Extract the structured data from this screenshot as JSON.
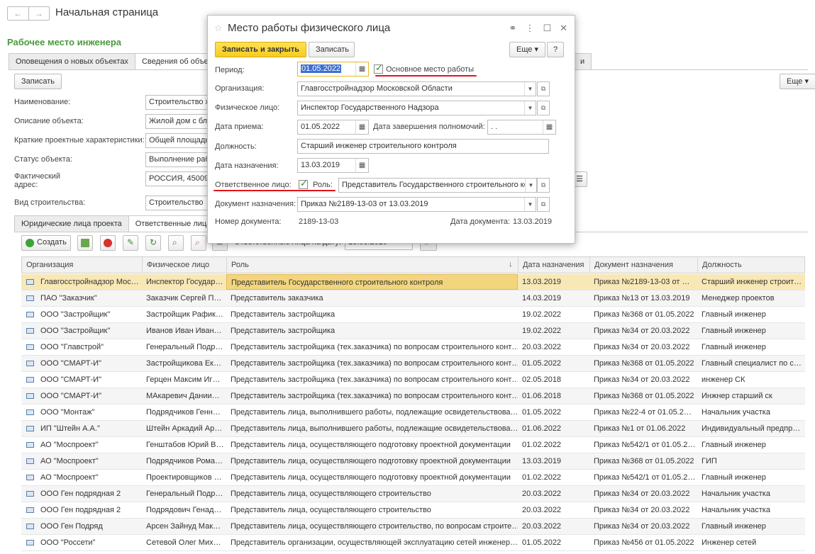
{
  "nav": {
    "back": "←",
    "forward": "→"
  },
  "page_title": "Начальная страница",
  "section_title": "Рабочее место инженера",
  "top_tabs": [
    "Оповещения о новых объектах",
    "Сведения об объекте",
    "и"
  ],
  "buttons": {
    "write": "Записать",
    "more": "Еще"
  },
  "form": {
    "name_label": "Наименование:",
    "name_value": "Строительство ж",
    "desc_label": "Описание объекта:",
    "desc_value": "Жилой дом с бла",
    "brief_label": "Краткие проектные характеристики:",
    "brief_value": "Общей площадь",
    "status_label": "Статус объекта:",
    "status_value": "Выполнение рабо",
    "address_label_1": "Фактический",
    "address_label_2": "адрес:",
    "address_value": "РОССИЯ, 45009",
    "type_label": "Вид строительства:",
    "type_value": "Строительство"
  },
  "bottom_tabs": [
    "Юридические лица проекта",
    "Ответственные лица"
  ],
  "toolbar": {
    "create": "Создать",
    "date_label": "Ответственные лица на дату:",
    "date_value": "13.03.2020"
  },
  "table": {
    "headers": [
      "Организация",
      "Физическое лицо",
      "Роль",
      "Дата назначения",
      "Документ назначения",
      "Должность"
    ],
    "sort_arrow": "↓",
    "rows": [
      [
        "Главгосстройнадзор Мос…",
        "Инспектор Государ…",
        "Представитель Государственного строительного контроля",
        "13.03.2019",
        "Приказ  №2189-13-03 от …",
        "Старший инженер строит…"
      ],
      [
        "ПАО \"Заказчик\"",
        "Заказчик Сергей П…",
        "Представитель заказчика",
        "14.03.2019",
        "Приказ №13 от 13.03.2019",
        "Менеджер проектов"
      ],
      [
        "ООО \"Застройщик\"",
        "Застройщик Рафик…",
        "Представитель застройщика",
        "19.02.2022",
        "Приказ №368 от 01.05.2022",
        "Главный инженер"
      ],
      [
        "ООО \"Застройщик\"",
        "Иванов Иван Иван…",
        "Представитель застройщика",
        "19.02.2022",
        "Приказ №34 от 20.03.2022",
        "Главный инженер"
      ],
      [
        "ООО \"Главстрой\"",
        "Генеральный Подр…",
        "Представитель застройщика (тех.заказчика) по вопросам строительного конт…",
        "20.03.2022",
        "Приказ №34 от 20.03.2022",
        "Главный инженер"
      ],
      [
        "ООО \"СМАРТ-И\"",
        "Застройщикова Ек…",
        "Представитель застройщика (тех.заказчика) по вопросам строительного конт…",
        "01.05.2022",
        "Приказ №368 от 01.05.2022",
        "Главный специалист по с…"
      ],
      [
        "ООО \"СМАРТ-И\"",
        "Герцен Максим Иг…",
        "Представитель застройщика (тех.заказчика) по вопросам строительного конт…",
        "02.05.2018",
        "Приказ №34 от 20.03.2022",
        "инженер СК"
      ],
      [
        "ООО \"СМАРТ-И\"",
        "МАкаревич Дании…",
        "Представитель застройщика (тех.заказчика) по вопросам строительного конт…",
        "01.06.2018",
        "Приказ №368 от 01.05.2022",
        "Инжнер старший ск"
      ],
      [
        "ООО \"Монтаж\"",
        "Подрядчиков Генн…",
        "Представитель лица, выполнившего работы, подлежащие освидетельствова…",
        "01.05.2022",
        "Приказ №22-4 от 01.05.2…",
        "Начальник участка"
      ],
      [
        "ИП \"Штейн А.А.\"",
        "Штейн Аркадий Ар…",
        "Представитель лица, выполнившего работы, подлежащие освидетельствова…",
        "01.06.2022",
        "Приказ №1 от 01.06.2022",
        "Индивидуальный предпр…"
      ],
      [
        "АО \"Моспроект\"",
        "Генштабов Юрий В…",
        "Представитель лица, осуществляющего подготовку проектной документации",
        "01.02.2022",
        "Приказ №542/1 от 01.05.2…",
        "Главный инженер"
      ],
      [
        "АО \"Моспроект\"",
        "Подрядчиков Рома…",
        "Представитель лица, осуществляющего подготовку проектной документации",
        "13.03.2019",
        "Приказ №368 от 01.05.2022",
        "ГИП"
      ],
      [
        "АО \"Моспроект\"",
        "Проектировщиков …",
        "Представитель лица, осуществляющего подготовку проектной документации",
        "01.02.2022",
        "Приказ №542/1 от 01.05.2…",
        "Главный инженер"
      ],
      [
        "ООО Ген подрядная 2",
        "Генеральный Подр…",
        "Представитель лица, осуществляющего строительство",
        "20.03.2022",
        "Приказ №34 от 20.03.2022",
        "Начальник участка"
      ],
      [
        "ООО Ген подрядная 2",
        "Подрядович Генад…",
        "Представитель лица, осуществляющего строительство",
        "20.03.2022",
        "Приказ №34 от 20.03.2022",
        "Начальник участка"
      ],
      [
        "ООО Ген Подряд",
        "Арсен Зайнуд Мак…",
        "Представитель лица, осуществляющего строительство, по вопросам строите…",
        "20.03.2022",
        "Приказ №34 от 20.03.2022",
        "Главный инженер"
      ],
      [
        "ООО \"Россети\"",
        "Сетевой Олег Мих…",
        "Представитель организации, осуществляющей эксплуатацию сетей инженер…",
        "01.05.2022",
        "Приказ №456 от 01.05.2022",
        "Инженер сетей"
      ]
    ]
  },
  "dialog": {
    "title": "Место работы физического лица",
    "save_close": "Записать и закрыть",
    "save": "Записать",
    "more": "Еще",
    "help": "?",
    "period_label": "Период:",
    "period_value": "01.05.2022",
    "main_work_label": "Основное место работы",
    "org_label": "Организация:",
    "org_value": "Главгосстройнадзор Московской Области",
    "person_label": "Физическое лицо:",
    "person_value": "Инспектор Государственного Надзора",
    "hire_label": "Дата приема:",
    "hire_value": "01.05.2022",
    "end_label": "Дата завершения полномочий:",
    "end_value": " .  .",
    "position_label": "Должность:",
    "position_value": "Старший инженер строительного контроля",
    "assign_label": "Дата назначения:",
    "assign_value": "13.03.2019",
    "responsible_label": "Ответственное лицо:",
    "role_label": "Роль:",
    "role_value": "Представитель Государственного строительного кон",
    "doc_label": "Документ назначения:",
    "doc_value": "Приказ  №2189-13-03 от 13.03.2019",
    "docnum_label": "Номер документа:",
    "docnum_value": "2189-13-03",
    "docdate_label": "Дата документа:",
    "docdate_value": "13.03.2019"
  },
  "colors": {
    "accent_green": "#4a9a3d",
    "primary_yellow": "#f6cc20",
    "selection": "#f8e8b6",
    "red_underline": "#e0141a"
  }
}
